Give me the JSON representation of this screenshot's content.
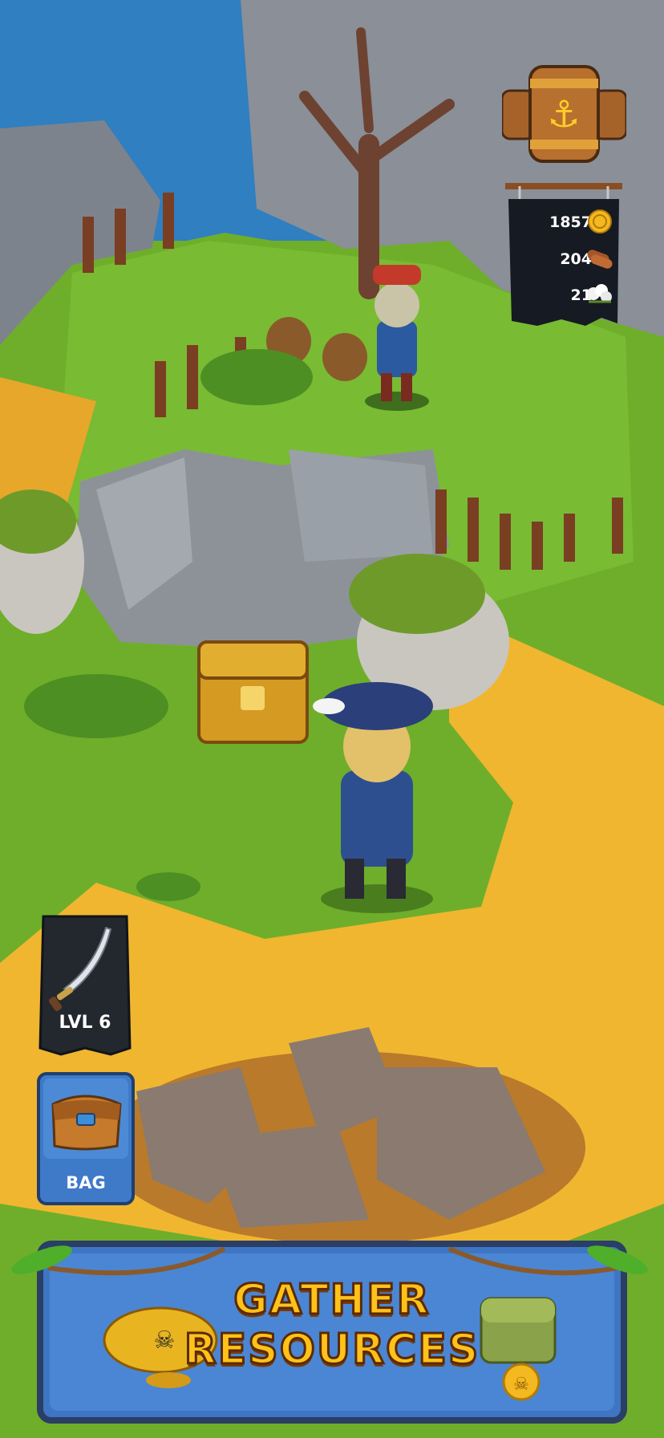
{
  "hud": {
    "resources": [
      {
        "name": "gold",
        "value": "1857",
        "icon": "gold-coin-icon"
      },
      {
        "name": "wood",
        "value": "204",
        "icon": "wood-log-icon"
      },
      {
        "name": "cotton",
        "value": "21",
        "icon": "cotton-icon"
      }
    ],
    "barrel_icon": "anchor-barrel-icon"
  },
  "weapon": {
    "label": "LVL 6",
    "icon": "cutlass-icon"
  },
  "bag": {
    "label": "BAG",
    "icon": "satchel-icon"
  },
  "banner": {
    "line1": "GATHER",
    "line2": "RESOURCES",
    "left_icon": "golden-pirate-hat-icon",
    "right_icon": "treasure-chest-coins-icon"
  },
  "colors": {
    "grass": "#6fae2a",
    "path": "#f0b630",
    "ui_blue": "#3f7ac8",
    "gold": "#ffc21a"
  }
}
